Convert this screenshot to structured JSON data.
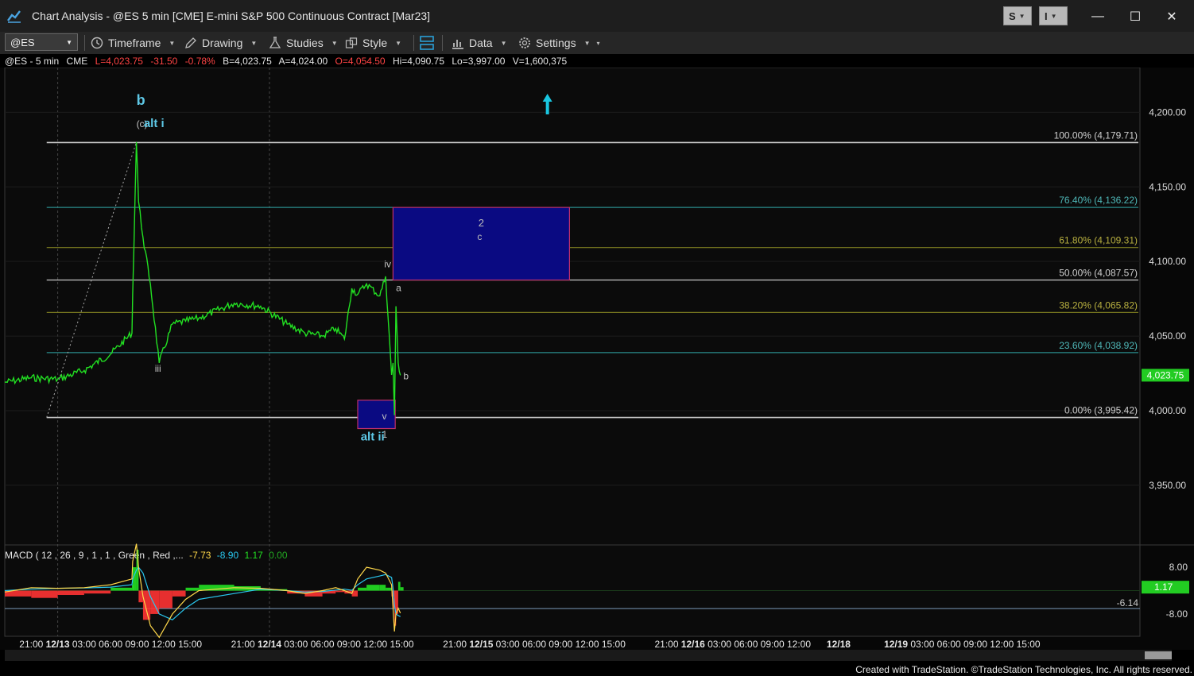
{
  "window": {
    "title": "Chart Analysis - @ES 5 min [CME] E-mini S&P 500 Continuous Contract [Mar23]",
    "btn_s": "S",
    "btn_i": "I",
    "minimize": "—",
    "maximize": "☐",
    "close": "✕"
  },
  "toolbar": {
    "symbol": "@ES",
    "timeframe": "Timeframe",
    "drawing": "Drawing",
    "studies": "Studies",
    "style": "Style",
    "data": "Data",
    "settings": "Settings"
  },
  "info": {
    "symbol": "@ES - 5 min",
    "exchange": "CME",
    "last": "L=4,023.75",
    "change": "-31.50",
    "pct": "-0.78%",
    "bid": "B=4,023.75",
    "ask": "A=4,024.00",
    "open": "O=4,054.50",
    "high": "Hi=4,090.75",
    "low": "Lo=3,997.00",
    "volume": "V=1,600,375"
  },
  "colors": {
    "price_line": "#22e022",
    "wave_label": "#5ec8e6",
    "fib_gray": "#c8c8c8",
    "fib_teal": "#2a8c8c",
    "fib_olive": "#7a7a20",
    "box_fill": "#0a0a82",
    "box_border": "#c0306a",
    "arrow": "#19c6e0",
    "last_price_tag": "#22cc22",
    "red": "#ff3333",
    "orange": "#ffaa33",
    "yellow": "#ffd84a"
  },
  "icons": {
    "app": "tradestation-chart-icon",
    "timeframe": "clock-icon",
    "drawing": "pen-icon",
    "studies": "flask-icon",
    "style": "style-icon",
    "data": "bar-chart-icon",
    "settings": "gear-icon"
  },
  "chart_data": {
    "type": "line",
    "series": [
      {
        "name": "@ES 5 min",
        "x": [
          "12/12 18:00",
          "12/12 21:00",
          "12/13 00:00",
          "12/13 03:00",
          "12/13 06:00",
          "12/13 08:25",
          "12/13 08:30",
          "12/13 08:55",
          "12/13 09:10",
          "12/13 09:40",
          "12/13 10:30",
          "12/13 11:30",
          "12/13 13:00",
          "12/13 14:30",
          "12/13 16:00",
          "12/13 20:00",
          "12/13 23:00",
          "12/14 02:00",
          "12/14 04:00",
          "12/14 06:00",
          "12/14 07:30",
          "12/14 08:30",
          "12/14 09:20",
          "12/14 10:00",
          "12/14 11:00",
          "12/14 12:30",
          "12/14 13:10",
          "12/14 13:50",
          "12/14 14:00",
          "12/14 14:10",
          "12/14 14:20",
          "12/14 14:35",
          "12/14 14:50"
        ],
        "values": [
          4019,
          4022,
          4021,
          4027,
          4038,
          4052,
          4078,
          4180,
          4140,
          4116,
          4085,
          4032,
          4058,
          4060,
          4062,
          4072,
          4070,
          4058,
          4052,
          4050,
          4055,
          4048,
          4082,
          4078,
          4085,
          4077,
          4090,
          4024,
          4032,
          3997,
          4070,
          4032,
          4023.75
        ]
      }
    ],
    "fib_levels": [
      {
        "label": "100.00% (4,179.71)",
        "price": 4179.71
      },
      {
        "label": "76.40% (4,136.22)",
        "price": 4136.22
      },
      {
        "label": "61.80% (4,109.31)",
        "price": 4109.31
      },
      {
        "label": "50.00% (4,087.57)",
        "price": 4087.57
      },
      {
        "label": "38.20% (4,065.82)",
        "price": 4065.82
      },
      {
        "label": "23.60% (4,038.92)",
        "price": 4038.92
      },
      {
        "label": "0.00% (3,995.42)",
        "price": 3995.42
      }
    ],
    "target_box_upper": {
      "label_top": "2",
      "label_bottom": "c",
      "from": "12/14 14:00",
      "to": "12/15 10:00",
      "y_top": 4136.22,
      "y_bottom": 4087.57
    },
    "target_box_lower": {
      "from": "12/14 10:00",
      "to": "12/14 14:15",
      "y_top": 4007,
      "y_bottom": 3988
    },
    "wave_labels": [
      {
        "text": "b",
        "x": "12/13 08:55",
        "y": 4205
      },
      {
        "text": "(c)",
        "x": "12/13 08:55",
        "y": 4190
      },
      {
        "text": "alt i",
        "x": "12/13 09:45",
        "y": 4190
      },
      {
        "text": "iii",
        "x": "12/13 11:00",
        "y": 4026
      },
      {
        "text": "iv",
        "x": "12/14 13:00",
        "y": 4096
      },
      {
        "text": "a",
        "x": "12/14 14:20",
        "y": 4080
      },
      {
        "text": "b",
        "x": "12/14 15:10",
        "y": 4021
      },
      {
        "text": "v",
        "x": "12/14 12:45",
        "y": 3994
      },
      {
        "text": "1",
        "x": "12/14 12:45",
        "y": 3982
      },
      {
        "text": "alt ii",
        "x": "12/14 10:20",
        "y": 3980
      }
    ],
    "y_ticks": [
      "4,200.00",
      "4,150.00",
      "4,100.00",
      "4,050.00",
      "4,000.00",
      "3,950.00"
    ],
    "y_tick_values": [
      4200,
      4150,
      4100,
      4050,
      4000,
      3950
    ],
    "ylim": [
      3910,
      4230
    ],
    "last_price": "4,023.75",
    "x_ticks": [
      {
        "label": "21:00",
        "bold": false
      },
      {
        "label": "12/13",
        "bold": true
      },
      {
        "label": "03:00",
        "bold": false
      },
      {
        "label": "06:00",
        "bold": false
      },
      {
        "label": "09:00",
        "bold": false
      },
      {
        "label": "12:00",
        "bold": false
      },
      {
        "label": "15:00",
        "bold": false
      },
      {
        "label": "21:00",
        "bold": false
      },
      {
        "label": "12/14",
        "bold": true
      },
      {
        "label": "03:00",
        "bold": false
      },
      {
        "label": "06:00",
        "bold": false
      },
      {
        "label": "09:00",
        "bold": false
      },
      {
        "label": "12:00",
        "bold": false
      },
      {
        "label": "15:00",
        "bold": false
      },
      {
        "label": "21:00",
        "bold": false
      },
      {
        "label": "12/15",
        "bold": true
      },
      {
        "label": "03:00",
        "bold": false
      },
      {
        "label": "06:00",
        "bold": false
      },
      {
        "label": "09:00",
        "bold": false
      },
      {
        "label": "12:00",
        "bold": false
      },
      {
        "label": "15:00",
        "bold": false
      },
      {
        "label": "21:00",
        "bold": false
      },
      {
        "label": "12/16",
        "bold": true
      },
      {
        "label": "03:00",
        "bold": false
      },
      {
        "label": "06:00",
        "bold": false
      },
      {
        "label": "09:00",
        "bold": false
      },
      {
        "label": "12:00",
        "bold": false
      },
      {
        "label": "12/18",
        "bold": true
      },
      {
        "label": "12/19",
        "bold": true
      },
      {
        "label": "03:00",
        "bold": false
      },
      {
        "label": "06:00",
        "bold": false
      },
      {
        "label": "09:00",
        "bold": false
      },
      {
        "label": "12:00",
        "bold": false
      },
      {
        "label": "15:00",
        "bold": false
      }
    ],
    "macd": {
      "label": "MACD ( 12 , 26 , 9 , 1 , 1 , Green , Red ,...",
      "macd_value": "-7.73",
      "signal_value": "-8.90",
      "hist_value": "1.17",
      "zero_value": "0.00",
      "y_ticks": [
        "8.00",
        "-8.00"
      ],
      "y_tick_values": [
        8,
        -8
      ],
      "ref_line": "-6.14",
      "ref_value": -6.14,
      "last_tag": "1.17",
      "ylim": [
        -14,
        14
      ],
      "histogram": [
        -2,
        -2.5,
        -1.5,
        -1,
        1,
        2,
        8,
        14,
        -4,
        -10,
        -8,
        -6,
        -2,
        1,
        2,
        1.5,
        0.5,
        -1,
        -2,
        -1,
        -0.5,
        -1,
        -2,
        1,
        2,
        2,
        1,
        -2,
        -6,
        -12,
        -8,
        3,
        1.17
      ],
      "macd_line": [
        -0.5,
        1,
        0.8,
        1,
        2,
        4,
        10,
        16,
        8,
        -2,
        -12,
        -16,
        -8,
        -3,
        0,
        1,
        0.8,
        0,
        -1,
        0,
        1,
        0,
        -1,
        4,
        8,
        7,
        6,
        2,
        -6,
        -14,
        -8,
        -6,
        -7.73
      ],
      "signal_line": [
        0,
        0.5,
        0.8,
        0.9,
        1.2,
        2,
        4,
        7,
        8,
        6,
        -2,
        -8,
        -10,
        -6,
        -3,
        -1,
        0.5,
        0,
        -0.5,
        -0.3,
        0.2,
        0.5,
        0.1,
        2,
        4,
        5,
        5.5,
        4.5,
        1,
        -5,
        -8,
        -8.5,
        -8.9
      ]
    }
  },
  "credit": "Created with TradeStation. ©TradeStation Technologies, Inc. All rights reserved."
}
